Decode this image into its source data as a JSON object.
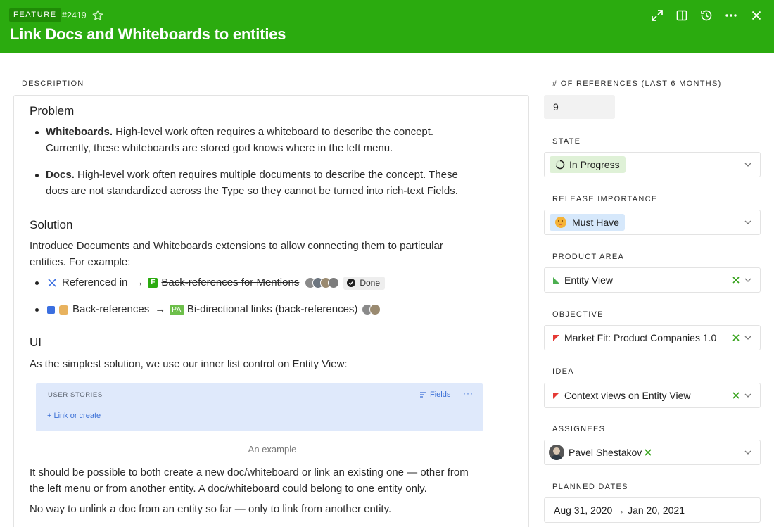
{
  "header": {
    "type_badge": "FEATURE",
    "entity_id": "#2419",
    "title": "Link Docs and Whiteboards to entities",
    "icons": [
      "expand-icon",
      "side-panel-icon",
      "history-icon",
      "more-icon",
      "close-icon"
    ],
    "color": "#2bab0f"
  },
  "description": {
    "label": "DESCRIPTION",
    "problem_heading": "Problem",
    "bullet1_strong": "Whiteboards.",
    "bullet1_line1": " High-level work often requires a whiteboard to describe the concept.",
    "bullet1_line2": "Currently, these whiteboards are stored god knows where in the left menu.",
    "bullet2_strong": "Docs.",
    "bullet2_line1": " High-level work often requires multiple documents to describe the concept. These",
    "bullet2_line2": "docs are not standardized across the Type so they cannot be turned into rich-text Fields.",
    "solution_heading": "Solution",
    "solution_line1": "Introduce Documents and Whiteboards extensions to allow connecting them to particular",
    "solution_line2": "entities. For example:",
    "example1": {
      "text": "Referenced in",
      "arrow": "→",
      "chip": "F",
      "link": "Back-references for Mentions",
      "status": "Done"
    },
    "example2": {
      "text": "Back-references",
      "arrow": "→",
      "chip": "PA",
      "link": "Bi-directional links (back-references)"
    },
    "ui_heading": "UI",
    "ui_line": "As the simplest solution, we use our inner list control on Entity View:",
    "embed": {
      "label": "USER STORIES",
      "fields": "Fields",
      "more": "···",
      "link": "+ Link or create"
    },
    "caption": "An example",
    "para1_line1": "It should be possible to both create a new doc/whiteboard or link an existing one — other from",
    "para1_line2": "the left menu or from another entity. A doc/whiteboard could belong to one entity only.",
    "para2": "No way to unlink a doc from an entity so far — only to link from another entity."
  },
  "fields": {
    "references": {
      "label": "# OF REFERENCES (LAST 6 MONTHS)",
      "value": "9"
    },
    "state": {
      "label": "STATE",
      "value": "In Progress"
    },
    "release_importance": {
      "label": "RELEASE IMPORTANCE",
      "value": "Must Have"
    },
    "product_area": {
      "label": "PRODUCT AREA",
      "value": "Entity View",
      "flag_color": "#4caf50"
    },
    "objective": {
      "label": "OBJECTIVE",
      "value": "Market Fit: Product Companies 1.0",
      "flag_color": "#e53935"
    },
    "idea": {
      "label": "IDEA",
      "value": "Context views on Entity View",
      "flag_color": "#e53935"
    },
    "assignees": {
      "label": "ASSIGNEES",
      "value": "Pavel Shestakov"
    },
    "planned_dates": {
      "label": "PLANNED DATES",
      "value": "Aug 31, 2020 → Jan 20, 2021"
    }
  }
}
